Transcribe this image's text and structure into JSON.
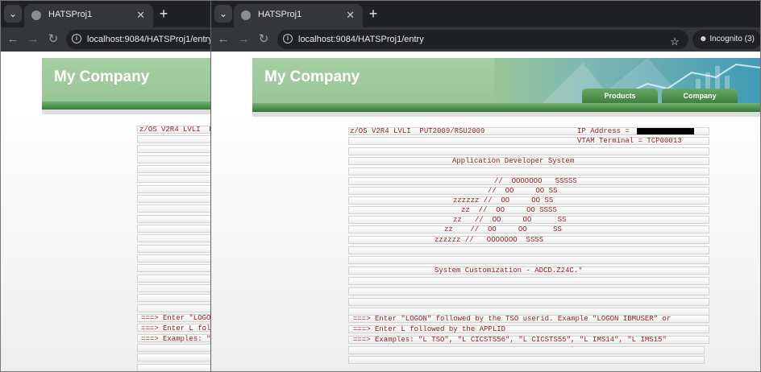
{
  "browser": {
    "tab_title": "HATSProj1",
    "url": "localhost:9084/HATSProj1/entry",
    "incognito_label": "Incognito (3)",
    "new_tab_label": "+",
    "close_tab_label": "✕"
  },
  "site": {
    "brand": "My Company",
    "nav": [
      "Products",
      "Company"
    ]
  },
  "terminal": {
    "rows": [
      {
        "text": "z/OS V2R4 LVLI  PUT2009/RSU2009",
        "right": "IP Address ="
      },
      {
        "text": "",
        "right": "VTAM Terminal = TCP00013"
      },
      {
        "text": ""
      },
      {
        "text": "Application Developer System",
        "indent": 128
      },
      {
        "text": ""
      },
      {
        "text": "//  OOOOOOO   SSSSS",
        "indent": 180
      },
      {
        "text": "//  OO     OO SS",
        "indent": 172
      },
      {
        "text": "zzzzzz //  OO     OO SS",
        "indent": 129
      },
      {
        "text": "zz  //  OO     OO SSSS",
        "indent": 139
      },
      {
        "text": "zz   //  OO     OO      SS",
        "indent": 129
      },
      {
        "text": "zz    //  OO     OO      SS",
        "indent": 118
      },
      {
        "text": "zzzzzz //   OOOOOOO  SSSS",
        "indent": 106
      },
      {
        "text": ""
      },
      {
        "text": ""
      },
      {
        "text": "System Customization - ADCD.Z24C.*",
        "indent": 106
      },
      {
        "text": ""
      },
      {
        "text": ""
      },
      {
        "text": ""
      },
      {
        "text": ""
      },
      {
        "text": "===> Enter \"LOGON\" followed by the TSO userid. Example \"LOGON IBMUSER\" or"
      },
      {
        "text": "===> Enter L followed by the APPLID"
      },
      {
        "text": "===> Examples: \"L TSO\", \"L CICSTS56\", \"L CICSTS55\", \"L IMS14\", \"L IMS15\""
      },
      {
        "text": ""
      },
      {
        "text": ""
      }
    ]
  }
}
